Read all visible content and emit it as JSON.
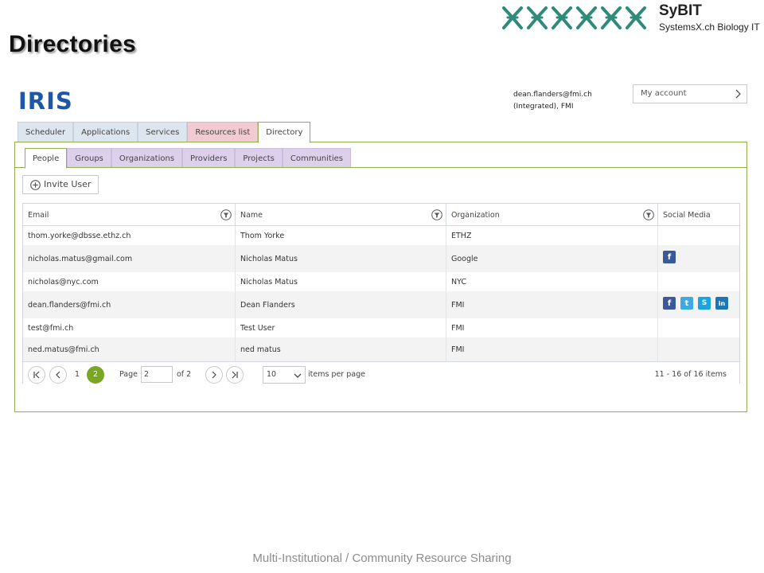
{
  "slide": {
    "title": "Directories",
    "footer": "Multi-Institutional / Community Resource Sharing"
  },
  "logo": {
    "brand": "SyBIT",
    "subtitle": "SystemsX.ch Biology IT",
    "accent_color": "#2e8b7a"
  },
  "app": {
    "logo": "IRIS",
    "user_email": "dean.flanders@fmi.ch",
    "user_org": "(Integrated), FMI",
    "account_label": "My account"
  },
  "main_tabs": [
    {
      "label": "Scheduler"
    },
    {
      "label": "Applications"
    },
    {
      "label": "Services"
    },
    {
      "label": "Resources list"
    },
    {
      "label": "Directory"
    }
  ],
  "sub_tabs": [
    {
      "label": "People"
    },
    {
      "label": "Groups"
    },
    {
      "label": "Organizations"
    },
    {
      "label": "Providers"
    },
    {
      "label": "Projects"
    },
    {
      "label": "Communities"
    }
  ],
  "invite_label": "Invite User",
  "table": {
    "columns": [
      "Email",
      "Name",
      "Organization",
      "Social Media"
    ],
    "rows": [
      {
        "email": "thom.yorke@dbsse.ethz.ch",
        "name": "Thom Yorke",
        "org": "ETHZ",
        "social": []
      },
      {
        "email": "nicholas.matus@gmail.com",
        "name": "Nicholas Matus",
        "org": "Google",
        "social": [
          "facebook"
        ]
      },
      {
        "email": "nicholas@nyc.com",
        "name": "Nicholas Matus",
        "org": "NYC",
        "social": []
      },
      {
        "email": "dean.flanders@fmi.ch",
        "name": "Dean Flanders",
        "org": "FMI",
        "social": [
          "facebook",
          "twitter",
          "skype",
          "linkedin"
        ]
      },
      {
        "email": "test@fmi.ch",
        "name": "Test User",
        "org": "FMI",
        "social": []
      },
      {
        "email": "ned.matus@fmi.ch",
        "name": "ned matus",
        "org": "FMI",
        "social": []
      }
    ]
  },
  "pager": {
    "page_1": "1",
    "page_2": "2",
    "page_label": "Page",
    "page_value": "2",
    "of_label": "of 2",
    "per_page_value": "10",
    "per_page_label": "items per page",
    "summary": "11 - 16 of 16 items",
    "active_color": "#7aa625"
  }
}
